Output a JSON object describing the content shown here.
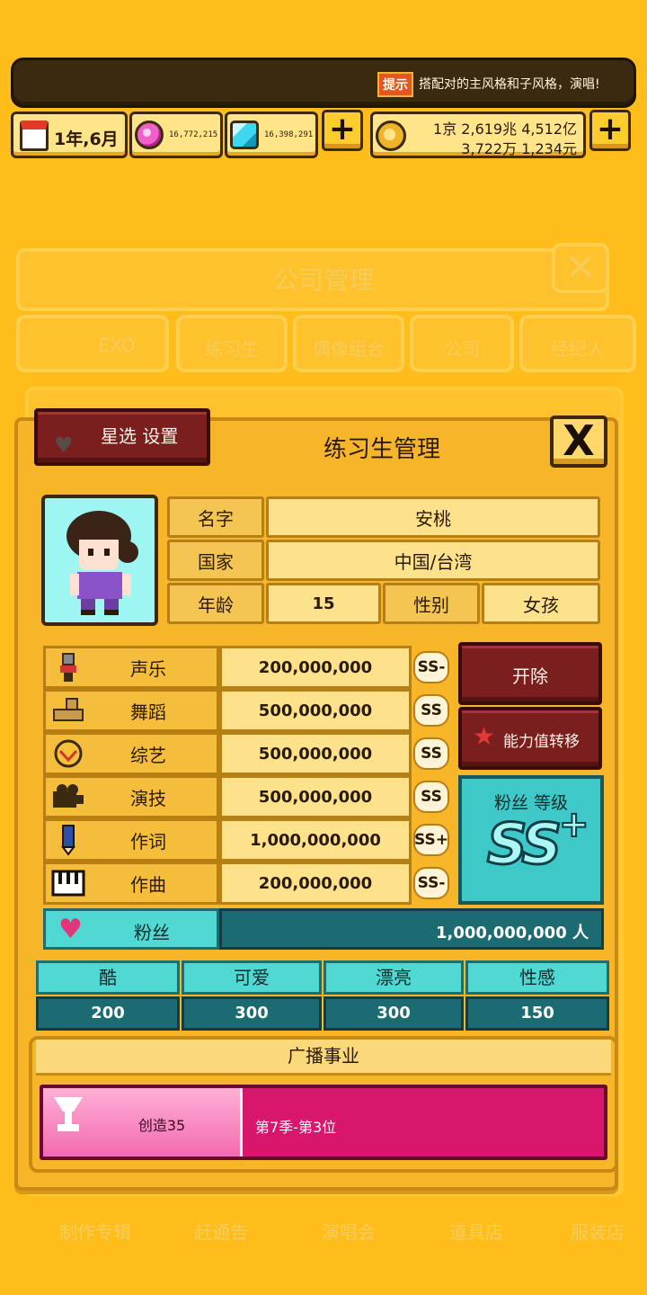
{
  "hud": {
    "tip_icon": "提示",
    "tip_text": "搭配对的主风格和子风格，演唱!",
    "date": "1年,6月",
    "pink_gems": "16,772,215",
    "blue_gems": "16,398,291",
    "money_line1": "1京 2,619兆 4,512亿",
    "money_line2": "3,722万 1,234元",
    "plus": "+"
  },
  "background": {
    "title": "公司管理",
    "tabs": [
      "EXO",
      "练习生",
      "偶像组合",
      "公司",
      "经纪人"
    ],
    "bottom_nav": [
      "制作专辑",
      "赶通告",
      "演唱会",
      "道具店",
      "服装店"
    ]
  },
  "modal": {
    "title": "练习生管理",
    "star_button": "星选 设置",
    "close": "X",
    "profile": {
      "name_label": "名字",
      "name": "安桃",
      "country_label": "国家",
      "country": "中国/台湾",
      "age_label": "年龄",
      "age": "15",
      "gender_label": "性别",
      "gender": "女孩"
    },
    "stats": [
      {
        "label": "声乐",
        "value": "200,000,000",
        "grade": "SS-",
        "icon": "microphone-icon"
      },
      {
        "label": "舞蹈",
        "value": "500,000,000",
        "grade": "SS",
        "icon": "shoe-icon"
      },
      {
        "label": "综艺",
        "value": "500,000,000",
        "grade": "SS",
        "icon": "smile-badge-icon"
      },
      {
        "label": "演技",
        "value": "500,000,000",
        "grade": "SS",
        "icon": "camera-icon"
      },
      {
        "label": "作词",
        "value": "1,000,000,000",
        "grade": "SS+",
        "icon": "pen-icon"
      },
      {
        "label": "作曲",
        "value": "200,000,000",
        "grade": "SS-",
        "icon": "piano-icon"
      }
    ],
    "fans": {
      "label": "粉丝",
      "value": "1,000,000,000 人"
    },
    "dismiss_button": "开除",
    "transfer_button": "能力值转移",
    "fan_grade_label": "粉丝 等级",
    "fan_grade": "SS",
    "fan_grade_plus": "+",
    "attributes": [
      {
        "label": "酷",
        "value": "200"
      },
      {
        "label": "可爱",
        "value": "300"
      },
      {
        "label": "漂亮",
        "value": "300"
      },
      {
        "label": "性感",
        "value": "150"
      }
    ],
    "broadcast": {
      "title": "广播事业",
      "show": "创造35",
      "result": "第7季-第3位"
    }
  },
  "colors": {
    "background": "#ffbd1c",
    "dark_button": "#7a1e1e",
    "teal": "#4fd9d2",
    "teal_dark": "#1c6b73",
    "pink": "#d8176c"
  }
}
